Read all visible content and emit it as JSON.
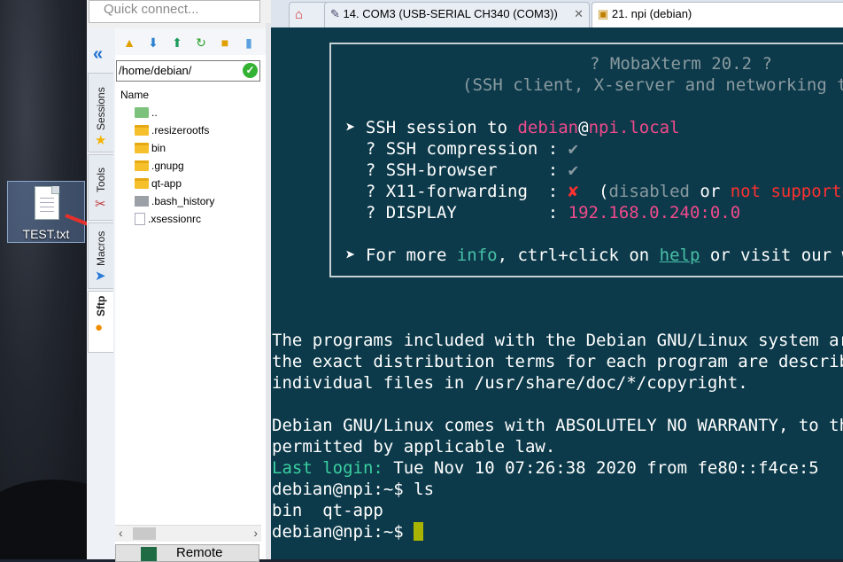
{
  "desktop": {
    "icon_label": "TEST.txt"
  },
  "quick_connect": {
    "placeholder": "Quick connect..."
  },
  "side_tabs": {
    "sessions": "Sessions",
    "tools": "Tools",
    "macros": "Macros",
    "sftp": "Sftp"
  },
  "sftp": {
    "path": "/home/debian/",
    "column_name": "Name",
    "files": [
      {
        "name": "..",
        "type": "up"
      },
      {
        "name": ".resizerootfs",
        "type": "folder"
      },
      {
        "name": "bin",
        "type": "folder"
      },
      {
        "name": ".gnupg",
        "type": "folder"
      },
      {
        "name": "qt-app",
        "type": "folder"
      },
      {
        "name": ".bash_history",
        "type": "bash"
      },
      {
        "name": ".xsessionrc",
        "type": "file"
      }
    ],
    "remote_label": "Remote"
  },
  "tabs": [
    {
      "label": "14. COM3  (USB-SERIAL CH340  (COM3))"
    },
    {
      "label": "21. npi (debian)"
    }
  ],
  "terminal": {
    "banner_title": "? MobaXterm 20.2 ?",
    "banner_sub": "(SSH client, X-server and networking tools)",
    "session_prefix": "➤ SSH session to ",
    "session_user": "debian",
    "session_at": "@",
    "session_host": "npi.local",
    "rows": [
      {
        "label": "  ? SSH compression : ",
        "value": "✔"
      },
      {
        "label": "  ? SSH-browser     : ",
        "value": "✔"
      },
      {
        "label": "  ? X11-forwarding  : ",
        "value": "✘"
      },
      {
        "label": "  ? DISPLAY         : ",
        "value": "192.168.0.240:0.0"
      }
    ],
    "x11_note_open": "  (",
    "x11_note_disabled": "disabled",
    "x11_note_or": " or ",
    "x11_note_notsupported": "not supported by server)",
    "info_prefix": "➤ For more ",
    "info_word": "info",
    "info_mid": ", ctrl+click on ",
    "info_help": "help",
    "info_end": " or visit our website.",
    "motd_1": "The programs included with the Debian GNU/Linux system are free software;",
    "motd_2": "the exact distribution terms for each program are described in the",
    "motd_3": "individual files in /usr/share/doc/*/copyright.",
    "motd_4": "Debian GNU/Linux comes with ABSOLUTELY NO WARRANTY, to the extent",
    "motd_5": "permitted by applicable law.",
    "last_login_label": "Last login:",
    "last_login_value": " Tue Nov 10 07:26:38 2020 from fe80::f4ce:5",
    "cmd_1": "debian@npi:~$ ls",
    "ls_output": "bin  qt-app",
    "prompt": "debian@npi:~$ "
  },
  "colors": {
    "terminal_bg": "#0c3a4a",
    "accent_magenta": "#f04a8c",
    "accent_teal": "#48c0a8",
    "cursor": "#a9b400"
  }
}
